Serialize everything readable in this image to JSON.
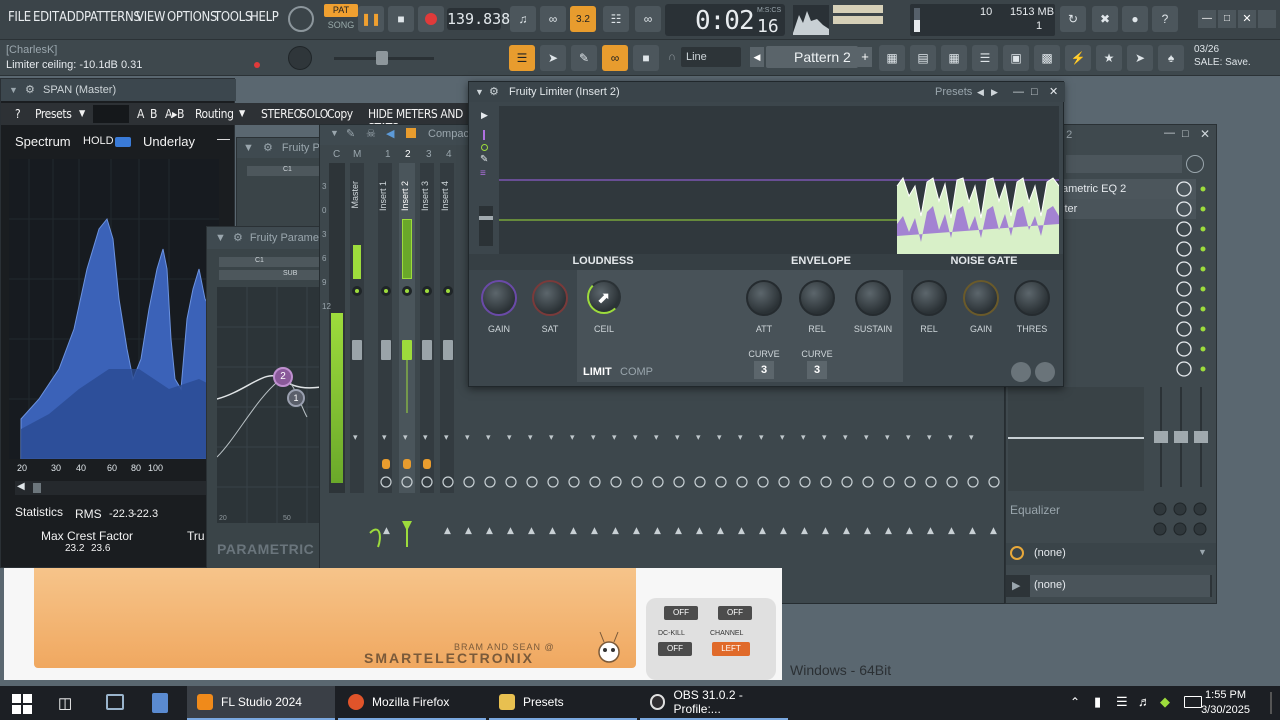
{
  "menu": {
    "items": [
      "FILE",
      "EDIT",
      "ADD",
      "PATTERNS",
      "VIEW",
      "OPTIONS",
      "TOOLS",
      "HELP"
    ]
  },
  "transport": {
    "pat_label": "PAT",
    "song_label": "SONG",
    "tempo": "139.838",
    "time": "0:02",
    "time_small": "16",
    "time_unit": "M:S:CS"
  },
  "cpu": {
    "cpu_value": "10",
    "memory": "1513 MB",
    "polyphony": "1"
  },
  "hint": {
    "user": "[CharlesK]",
    "text": "Limiter ceiling: -10.1dB  0.31"
  },
  "toolbar2": {
    "snap": "Line",
    "pattern": "Pattern 2"
  },
  "news": {
    "date": "03/26",
    "text": "SALE: Save."
  },
  "span": {
    "title": "SPAN (Master)",
    "help": "?",
    "presets": "Presets",
    "a": "A",
    "b": "B",
    "ab": "A▸B",
    "routing": "Routing",
    "stereo": "STEREO",
    "solo": "SOLO",
    "copy": "Copy",
    "hide": "HIDE METERS AND STATS",
    "spectrum": "Spectrum",
    "hold": "HOLD",
    "underlay": "Underlay",
    "freq_ticks": [
      "20",
      "30",
      "40",
      "60",
      "80",
      "100"
    ],
    "statistics": "Statistics",
    "rms_label": "RMS",
    "rms_l": "-22.3",
    "rms_r": "-22.3",
    "crest_label": "Max Crest Factor",
    "crest_l": "23.2",
    "crest_r": "23.6",
    "tru": "Tru"
  },
  "eq": {
    "title1": "Fruity Pa",
    "title2": "Fruity Paramet",
    "footer": "PARAMETRIC E",
    "c1": "C1",
    "sub": "SUB",
    "band1": "2",
    "band2": "1",
    "tick20": "20",
    "tick50": "50"
  },
  "mixer": {
    "title": "Compac",
    "tabs": [
      "C",
      "M",
      "1",
      "2",
      "3",
      "4"
    ],
    "channels": [
      "Master",
      "Insert 1",
      "Insert 2",
      "Insert 3",
      "Insert 4"
    ],
    "scale": [
      "3",
      "0",
      "3",
      "6",
      "9",
      "12"
    ]
  },
  "limiter": {
    "title": "Fruity Limiter (Insert 2)",
    "presets": "Presets",
    "sections": [
      "LOUDNESS",
      "ENVELOPE",
      "NOISE GATE"
    ],
    "knobs_loudness": [
      "GAIN",
      "SAT",
      "CEIL"
    ],
    "knobs_envelope": [
      "ATT",
      "REL",
      "SUSTAIN"
    ],
    "knobs_gate": [
      "REL",
      "GAIN",
      "THRES"
    ],
    "curve_label": "CURVE",
    "curve1": "3",
    "curve2": "3",
    "mode_limit": "LIMIT",
    "mode_comp": "COMP"
  },
  "rightwin": {
    "title_suffix": "t 2",
    "items": [
      "ametric EQ 2",
      "iter"
    ],
    "equalizer": "Equalizer",
    "slot1": "(none)",
    "slot2": "(none)"
  },
  "smartex": {
    "brand_small": "BRAM AND SEAN @",
    "brand": "SMARTELECTRONIX",
    "off1": "OFF",
    "off2": "OFF",
    "dckill": "DC-KILL",
    "channel": "CHANNEL",
    "off3": "OFF",
    "left": "LEFT"
  },
  "desktop": {
    "text": "Windows - 64Bit"
  },
  "taskbar": {
    "apps": [
      "FL Studio 2024",
      "Mozilla Firefox",
      "Presets",
      "OBS 31.0.2 - Profile:..."
    ],
    "time": "1:55 PM",
    "date": "3/30/2025"
  },
  "colors": {
    "accent_orange": "#f0a030",
    "green": "#9ddc3c",
    "purple": "#8a5cc8",
    "spectrum_blue": "#3b62b8"
  }
}
